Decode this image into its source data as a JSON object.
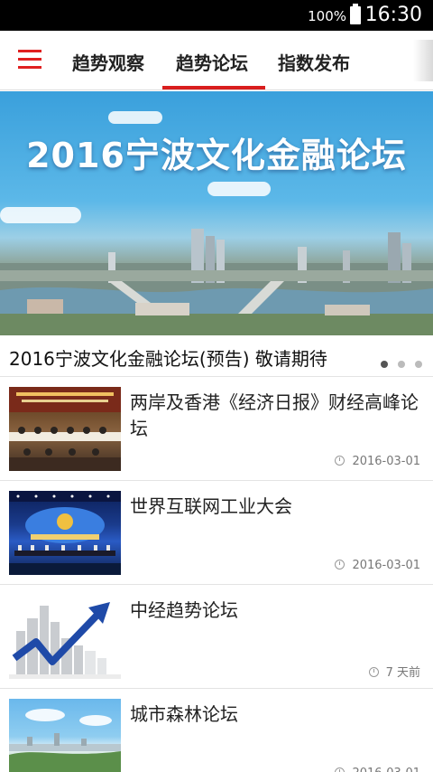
{
  "status_bar": {
    "battery_percent": "100%",
    "time": "16:30"
  },
  "nav": {
    "tabs": [
      {
        "label": "趋势观察"
      },
      {
        "label": "趋势论坛"
      },
      {
        "label": "指数发布"
      }
    ],
    "active_tab": "趋势论坛",
    "accent_color": "#d91e1e"
  },
  "banner": {
    "image_title": "2016宁波文化金融论坛",
    "caption": "2016宁波文化金融论坛(预告)  敬请期待",
    "slide_count": 3,
    "active_slide": 1
  },
  "news": [
    {
      "title": "两岸及香港《经济日报》财经高峰论坛",
      "time": "2016-03-01",
      "thumb": "conference-hall"
    },
    {
      "title": "世界互联网工业大会",
      "time": "2016-03-01",
      "thumb": "stage-blue"
    },
    {
      "title": "中经趋势论坛",
      "time": "7 天前",
      "thumb": "city-arrow"
    },
    {
      "title": "城市森林论坛",
      "time": "2016-03-01",
      "thumb": "forest-city"
    }
  ]
}
